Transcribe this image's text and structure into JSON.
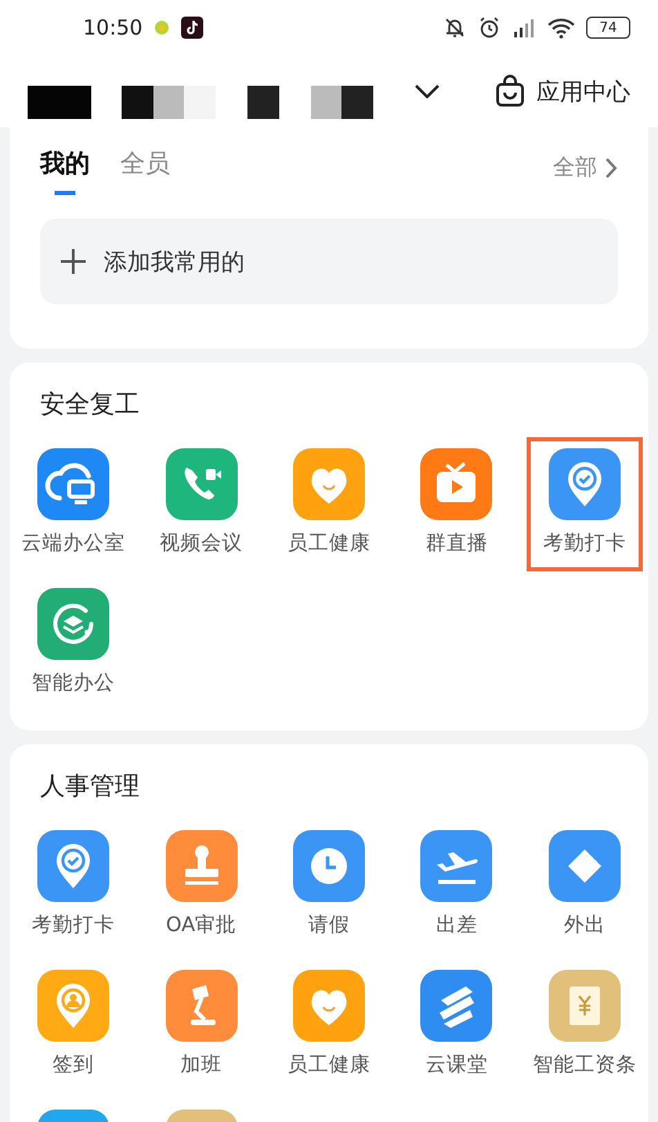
{
  "status_bar": {
    "time": "10:50",
    "battery": "74"
  },
  "header": {
    "app_center": "应用中心"
  },
  "favorites": {
    "tabs": [
      {
        "label": "我的",
        "selected": true
      },
      {
        "label": "全员",
        "selected": false
      }
    ],
    "all_link": "全部",
    "add_button": "添加我常用的"
  },
  "sections": [
    {
      "title": "安全复工",
      "apps": [
        {
          "label": "云端办公室",
          "kind": "cloud",
          "color": "#1e88f5",
          "highlighted": false
        },
        {
          "label": "视频会议",
          "kind": "video",
          "color": "#1fb67e",
          "highlighted": false
        },
        {
          "label": "员工健康",
          "kind": "heart",
          "color": "#ffa20f",
          "highlighted": false
        },
        {
          "label": "群直播",
          "kind": "tv",
          "color": "#ff7a14",
          "highlighted": false
        },
        {
          "label": "考勤打卡",
          "kind": "pincheck",
          "color": "#3b95f5",
          "highlighted": true
        },
        {
          "label": "智能办公",
          "kind": "layers",
          "color": "#21ad73",
          "highlighted": false
        }
      ]
    },
    {
      "title": "人事管理",
      "apps": [
        {
          "label": "考勤打卡",
          "kind": "pincheck",
          "color": "#3b95f5",
          "highlighted": false
        },
        {
          "label": "OA审批",
          "kind": "stamp",
          "color": "#ff8c3a",
          "highlighted": false
        },
        {
          "label": "请假",
          "kind": "clock",
          "color": "#3b95f5",
          "highlighted": false
        },
        {
          "label": "出差",
          "kind": "plane",
          "color": "#3b95f5",
          "highlighted": false
        },
        {
          "label": "外出",
          "kind": "tag",
          "color": "#3b95f5",
          "highlighted": false
        },
        {
          "label": "签到",
          "kind": "pinperson",
          "color": "#ffaa14",
          "highlighted": false
        },
        {
          "label": "加班",
          "kind": "lamp",
          "color": "#ff8c3a",
          "highlighted": false
        },
        {
          "label": "员工健康",
          "kind": "heart",
          "color": "#ffa20f",
          "highlighted": false
        },
        {
          "label": "云课堂",
          "kind": "stripes",
          "color": "#2f8cf0",
          "highlighted": false
        },
        {
          "label": "智能工资条",
          "kind": "scroll",
          "color": "#e1c079",
          "highlighted": false
        },
        {
          "kind": "blank",
          "color": "#1fa8ee",
          "highlighted": false
        },
        {
          "kind": "blank",
          "color": "#e1c079",
          "highlighted": false
        }
      ]
    }
  ]
}
